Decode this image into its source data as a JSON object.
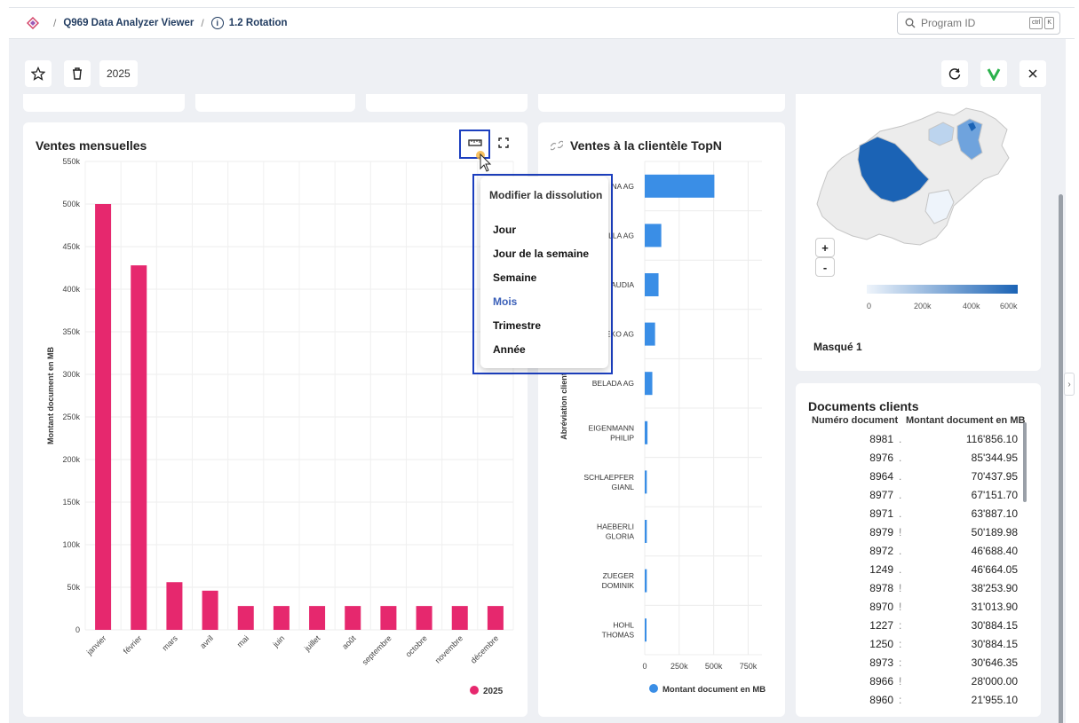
{
  "header": {
    "breadcrumb_app": "Q969 Data Analyzer Viewer",
    "breadcrumb_page": "1.2 Rotation",
    "search_placeholder": "Program ID",
    "kbd1": "ctrl",
    "kbd2": "K"
  },
  "toolbar": {
    "year": "2025"
  },
  "monthly_chart": {
    "title": "Ventes mensuelles",
    "legend": "2025",
    "bar_color": "#e6286e"
  },
  "topn_chart": {
    "title": "Ventes à la clientèle TopN",
    "legend": "Montant document en MB",
    "bar_color": "#3a8ee6"
  },
  "menu": {
    "header": "Modifier la dissolution",
    "items": [
      "Jour",
      "Jour de la semaine",
      "Semaine",
      "Mois",
      "Trimestre",
      "Année"
    ],
    "selected": "Mois"
  },
  "map": {
    "zoom_in": "+",
    "zoom_out": "-",
    "scale_labels": [
      "0",
      "200k",
      "400k",
      "600k"
    ],
    "caption": "Masqué 1"
  },
  "documents": {
    "title": "Documents clients",
    "col1": "Numéro document",
    "col2": "Montant document en MB",
    "rows": [
      [
        "8981",
        "116'856.10"
      ],
      [
        "8976",
        "85'344.95"
      ],
      [
        "8964",
        "70'437.95"
      ],
      [
        "8977",
        "67'151.70"
      ],
      [
        "8971",
        "63'887.10"
      ],
      [
        "8979",
        "50'189.98"
      ],
      [
        "8972",
        "46'688.40"
      ],
      [
        "1249",
        "46'664.05"
      ],
      [
        "8978",
        "38'253.90"
      ],
      [
        "8970",
        "31'013.90"
      ],
      [
        "1227",
        "30'884.15"
      ],
      [
        "1250",
        "30'884.15"
      ],
      [
        "8973",
        "30'646.35"
      ],
      [
        "8966",
        "28'000.00"
      ],
      [
        "8960",
        "21'955.10"
      ]
    ],
    "row_marks": [
      ".",
      ".",
      ".",
      ".",
      ".",
      "!",
      ".",
      ".",
      "!",
      "!",
      ":",
      ":",
      ":",
      "!",
      ":"
    ]
  },
  "chart_data": [
    {
      "type": "bar",
      "categories": [
        "janvier",
        "février",
        "mars",
        "avril",
        "mai",
        "juin",
        "juillet",
        "août",
        "septembre",
        "octobre",
        "novembre",
        "décembre"
      ],
      "series": [
        {
          "name": "2025",
          "values": [
            500000,
            428000,
            56000,
            46000,
            28000,
            28000,
            28000,
            28000,
            28000,
            28000,
            28000,
            28000
          ]
        }
      ],
      "ylabel": "Montant document en MB",
      "ylim": [
        0,
        550000
      ],
      "yticks": [
        "0",
        "50k",
        "100k",
        "150k",
        "200k",
        "250k",
        "300k",
        "350k",
        "400k",
        "450k",
        "500k",
        "550k"
      ],
      "legend_position": "bottom-right",
      "grid": true
    },
    {
      "type": "bar",
      "orientation": "horizontal",
      "categories": [
        "NA AG",
        "LLA AG",
        "AUDIA",
        "EKO AG",
        "BELADA AG",
        "EIGENMANN PHILIP",
        "SCHLAEPFER GIANL",
        "HAEBERLI GLORIA",
        "ZUEGER DOMINIK",
        "HOHL THOMAS"
      ],
      "series": [
        {
          "name": "Montant document en MB",
          "values": [
            505000,
            120000,
            100000,
            75000,
            55000,
            20000,
            15000,
            15000,
            15000,
            10000
          ]
        }
      ],
      "xlim": [
        0,
        850000
      ],
      "xticks": [
        "0",
        "250k",
        "500k",
        "750k"
      ],
      "ylabel": "Abréviation client",
      "legend_position": "bottom",
      "grid": true
    }
  ]
}
